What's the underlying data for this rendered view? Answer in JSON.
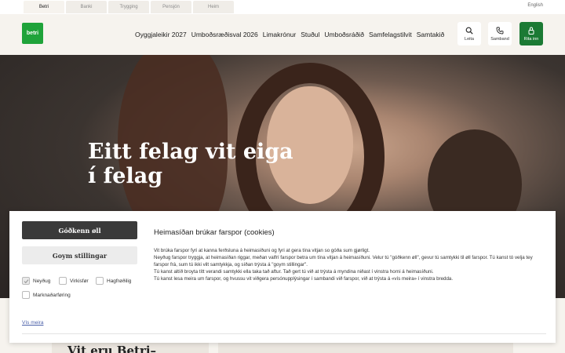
{
  "brand_tabs": [
    {
      "label": "Betri",
      "active": true
    },
    {
      "label": "Banki",
      "active": false
    },
    {
      "label": "Trygging",
      "active": false
    },
    {
      "label": "Pensjón",
      "active": false
    },
    {
      "label": "Heim",
      "active": false
    }
  ],
  "language": "English",
  "logo_text": "betri",
  "nav": [
    "Oyggjaleikir 2027",
    "Umboðsræðisval 2026",
    "Limakrónur",
    "Stuðul",
    "Umboðsráðið",
    "Samfelagstilvit",
    "Samtakið"
  ],
  "header_buttons": {
    "search": "Leita",
    "contact": "Samband",
    "login": "Rita inn"
  },
  "hero": {
    "title": "Eitt felag vit eiga í felag"
  },
  "below": {
    "title": "Vit eru Betri–"
  },
  "cookie": {
    "accept_all": "Góðkenn øll",
    "save_settings": "Goym stillingar",
    "checkboxes": [
      {
        "label": "Neyðug",
        "checked": true
      },
      {
        "label": "Virkisfør",
        "checked": false
      },
      {
        "label": "Hagfrøðilig",
        "checked": false
      },
      {
        "label": "Marknaðarføring",
        "checked": false
      }
    ],
    "more_link": "Vís meira",
    "title": "Heimasíðan brúkar farspor (cookies)",
    "body": [
      "Vit brúka farspor fyri at kanna ferðsluna á heimasíðuni og fyri at gera tína vitjan so góða sum gjørligt.",
      "Neyðug farspor tryggja, at heimasíðan riggar, meðan valfrí farspor betra um tína vitjan á heimasíðuni. Velur tú \"góðkenn øll\", gevur tú samtykki til øll farspor. Tú kanst tó velja tey farspor frá, sum tú ikki vilt samtykkja, og síðan trýsta á \"goym stillingar\".",
      "Tú kanst altíð broyta títt verandi samtykki ella taka tað aftur. Tað gert tú við at trýsta á myndina niðast í vinstra horni á heimasíðuni.",
      "Tú kanst lesa meira um farspor, og hvussu vit viðgera persónupplýsingar í sambandi við farspor, við at trýsta á «vís meira» í vinstra bredda."
    ]
  },
  "colors": {
    "brand_green": "#1fa33a",
    "login_green": "#1b7a34",
    "accept_dark": "#3a3a3a",
    "page_bg": "#f6f3ee"
  }
}
